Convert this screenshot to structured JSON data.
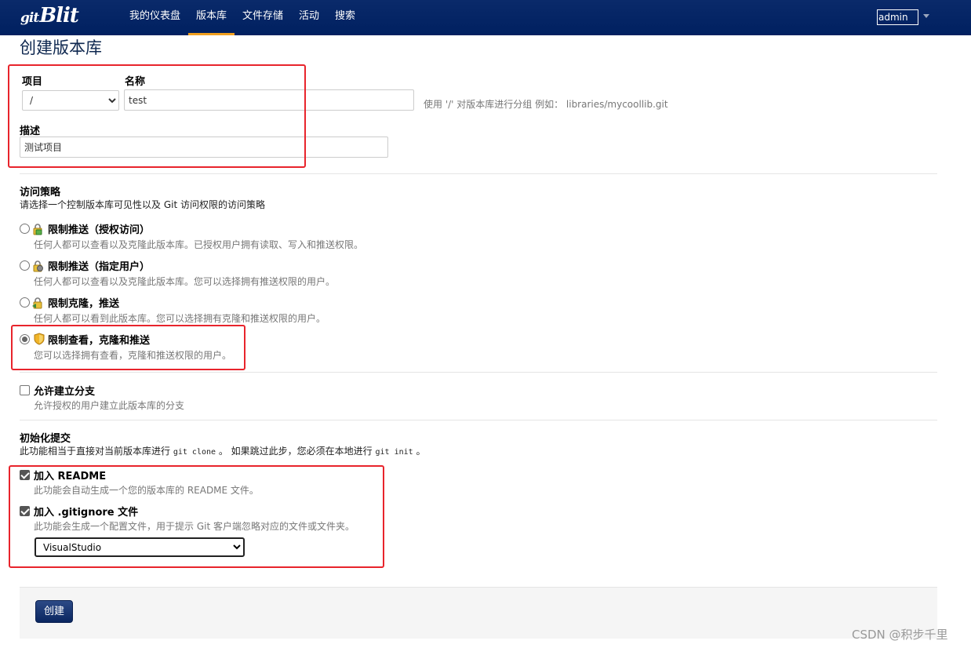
{
  "nav": {
    "brand_prefix": "git",
    "brand_main": "Blit",
    "items": [
      "我的仪表盘",
      "版本库",
      "文件存储",
      "活动",
      "搜索"
    ],
    "active": "版本库",
    "user": "admin"
  },
  "page": {
    "title": "创建版本库"
  },
  "form": {
    "project_label": "项目",
    "project_value": "/",
    "name_label": "名称",
    "name_value": "test",
    "name_hint": "使用 '/' 对版本库进行分组 例如： libraries/mycoollib.git",
    "desc_label": "描述",
    "desc_value": "测试项目"
  },
  "access": {
    "title": "访问策略",
    "subtitle": "请选择一个控制版本库可见性以及 Git 访问权限的访问策略",
    "selected_index": 3,
    "options": [
      {
        "label": "限制推送（授权访问）",
        "desc": "任何人都可以查看以及克隆此版本库。已授权用户拥有读取、写入和推送权限。",
        "icon": "lock-icon"
      },
      {
        "label": "限制推送（指定用户）",
        "desc": "任何人都可以查看以及克隆此版本库。您可以选择拥有推送权限的用户。",
        "icon": "lock-icon"
      },
      {
        "label": "限制克隆，推送",
        "desc": "任何人都可以看到此版本库。您可以选择拥有克隆和推送权限的用户。",
        "icon": "lock-icon"
      },
      {
        "label": "限制查看，克隆和推送",
        "desc": "您可以选择拥有查看，克隆和推送权限的用户。",
        "icon": "shield-icon"
      }
    ]
  },
  "fork": {
    "label": "允许建立分支",
    "desc": "允许授权的用户建立此版本库的分支",
    "checked": false
  },
  "init": {
    "title": "初始化提交",
    "desc_prefix": "此功能相当于直接对当前版本库进行",
    "cmd_clone": "git clone",
    "desc_middle": "。 如果跳过此步，您必须在本地进行",
    "cmd_init": "git init",
    "desc_suffix": "。",
    "readme_label": "加入 README",
    "readme_desc": "此功能会自动生成一个您的版本库的 README 文件。",
    "readme_checked": true,
    "gitignore_label": "加入 .gitignore 文件",
    "gitignore_desc": "此功能会生成一个配置文件，用于提示 Git 客户端忽略对应的文件或文件夹。",
    "gitignore_checked": true,
    "gitignore_value": "VisualStudio"
  },
  "actions": {
    "create_label": "创建"
  },
  "watermark": "CSDN @积步千里",
  "colors": {
    "nav_bg": "#002060",
    "active_accent": "#f0a020",
    "highlight_box": "#e8242c"
  }
}
